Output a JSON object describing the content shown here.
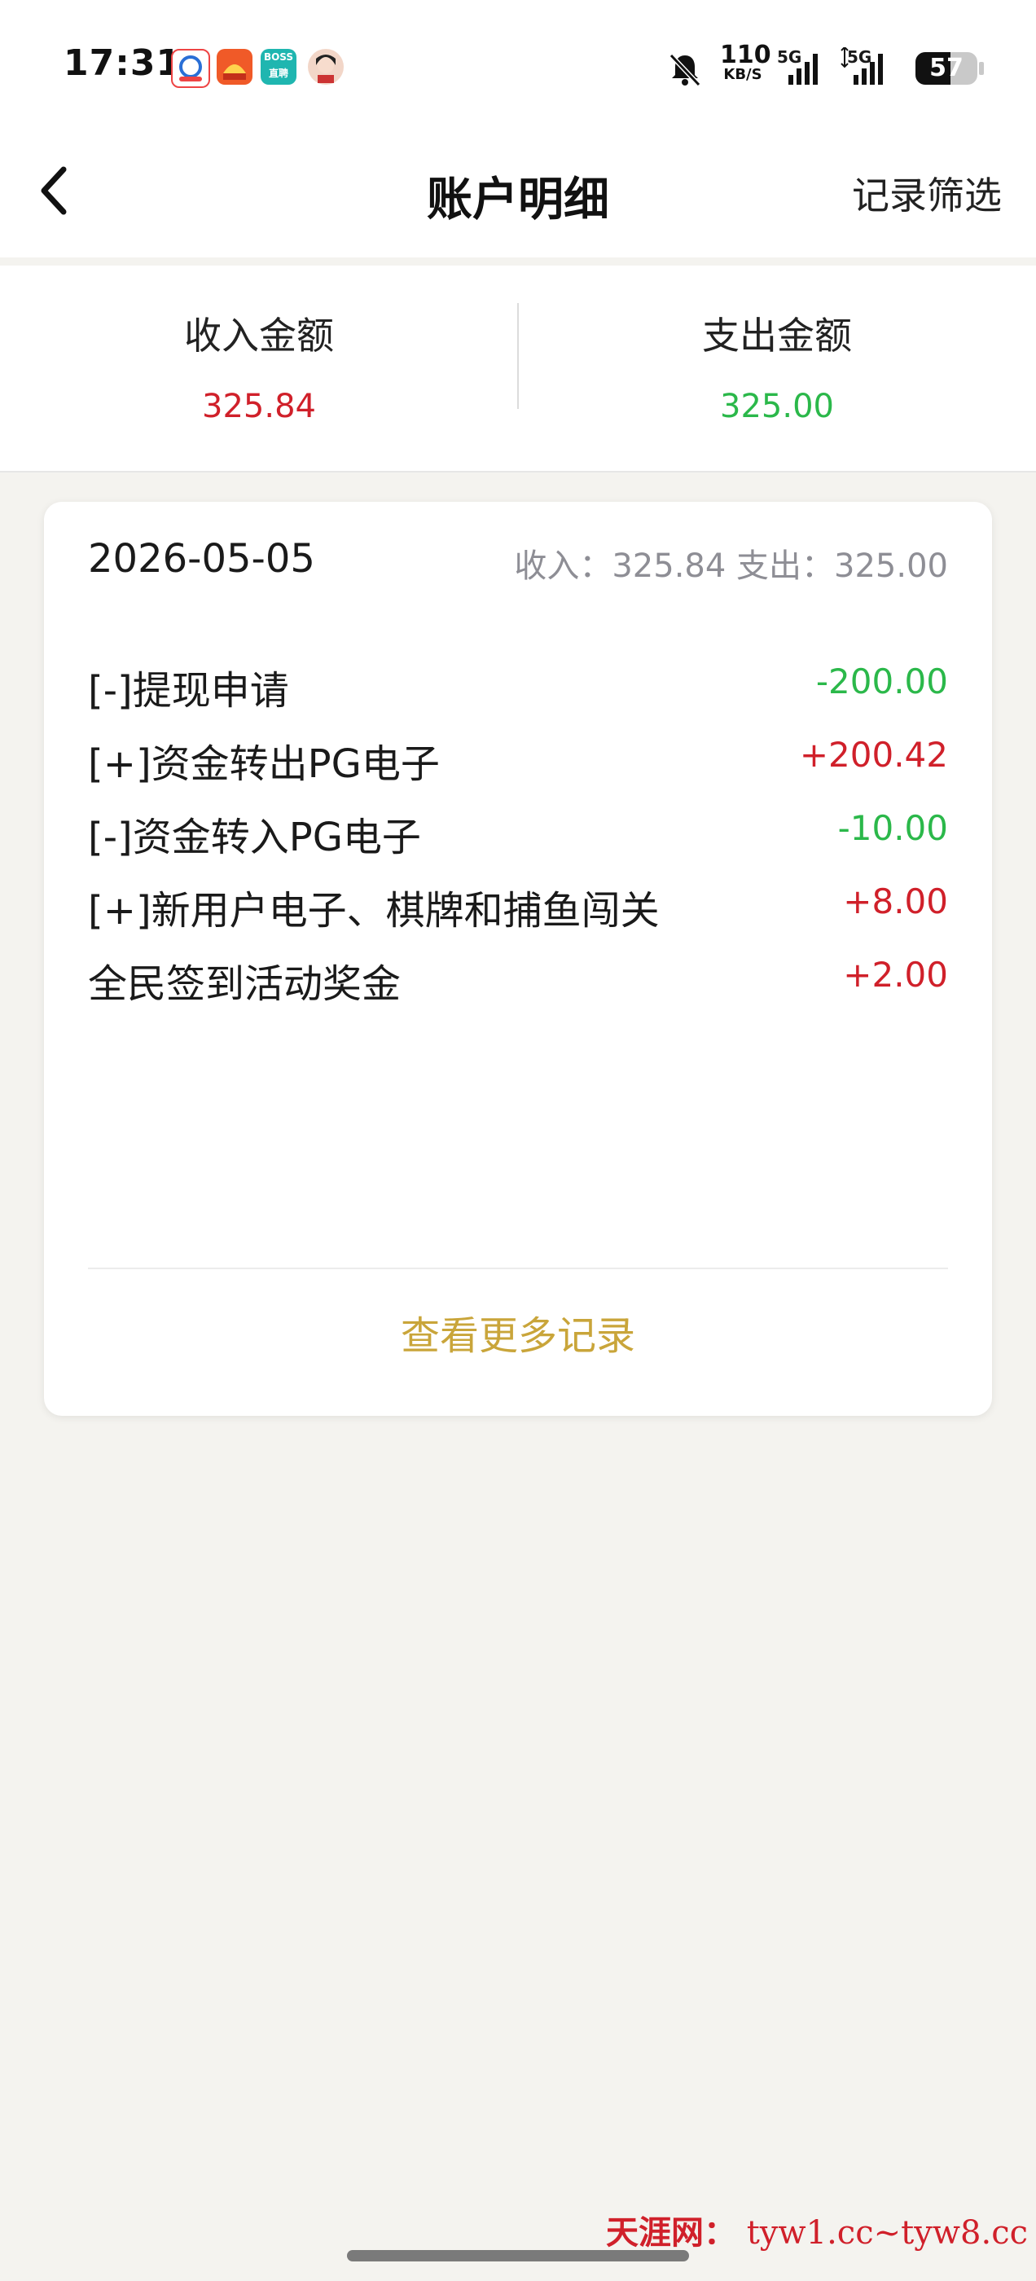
{
  "status_bar": {
    "time": "17:31",
    "net_speed_value": "110",
    "net_speed_unit": "KB/S",
    "signal_1_label": "5G",
    "signal_2_label": "5G",
    "battery_level": "57",
    "icons": [
      "app-icon-1",
      "app-icon-2",
      "boss-zhipin-icon",
      "avatar-icon",
      "bell-muted-icon",
      "signal-icon",
      "signal-icon",
      "battery-icon"
    ],
    "boss_icon_text": "BOSS 直聘"
  },
  "nav": {
    "title": "账户明细",
    "filter_label": "记录筛选",
    "back_icon": "chevron-left-icon"
  },
  "summary": {
    "income_label": "收入金额",
    "income_value": "325.84",
    "expense_label": "支出金额",
    "expense_value": "325.00",
    "income_color": "#d0202a",
    "expense_color": "#2bb84a"
  },
  "records": {
    "date": "2026-05-05",
    "totals": "收入：325.84 支出：325.00",
    "items": [
      {
        "name": "[-]提现申请",
        "amount": "-200.00",
        "type": "expense"
      },
      {
        "name": "[+]资金转出PG电子",
        "amount": "+200.42",
        "type": "income"
      },
      {
        "name": "[-]资金转入PG电子",
        "amount": "-10.00",
        "type": "expense"
      },
      {
        "name": "[+]新用户电子、棋牌和捕鱼闯关",
        "amount": "+8.00",
        "type": "income"
      },
      {
        "name": "全民签到活动奖金",
        "amount": "+2.00",
        "type": "income"
      }
    ],
    "more_label": "查看更多记录",
    "more_color": "#c9a53a"
  },
  "watermark": {
    "site_name": "天涯网：",
    "urls": "tyw1.cc~tyw8.cc"
  }
}
